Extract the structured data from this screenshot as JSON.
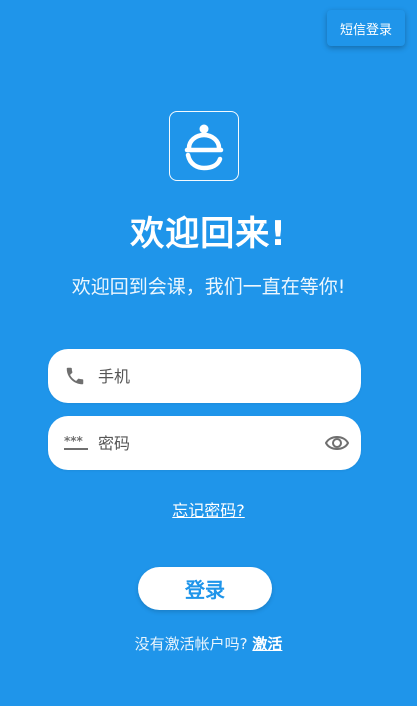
{
  "header": {
    "sms_login_label": "短信登录"
  },
  "hero": {
    "logo_icon": "app-logo-icon",
    "title": "欢迎回来!",
    "subtitle": "欢迎回到会课，我们一直在等你!"
  },
  "form": {
    "phone": {
      "placeholder": "手机",
      "value": "",
      "icon": "phone-icon"
    },
    "password": {
      "placeholder": "密码",
      "value": "",
      "icon": "password-dots-icon",
      "toggle_icon": "eye-icon"
    },
    "forgot_label": "忘记密码?",
    "login_label": "登录"
  },
  "footer": {
    "prompt": "没有激活帐户吗?",
    "activate_label": "激活"
  },
  "colors": {
    "background": "#1f95ea",
    "accent": "#1f95ea",
    "field_bg": "#ffffff"
  }
}
